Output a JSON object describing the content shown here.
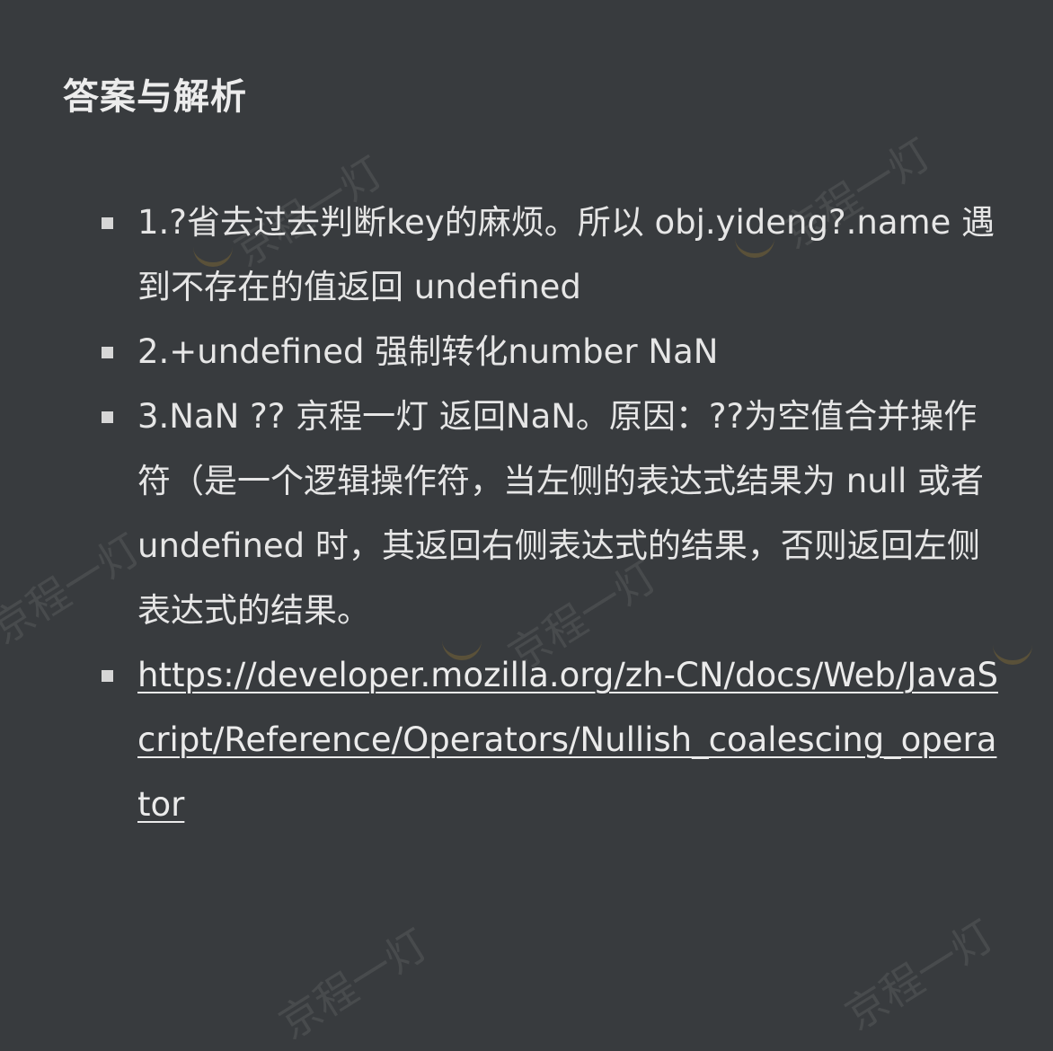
{
  "heading": "答案与解析",
  "items": [
    {
      "text": "1.?省去过去判断key的麻烦。所以 obj.yideng?.name 遇到不存在的值返回 undefined"
    },
    {
      "text": "2.+undefined 强制转化number NaN"
    },
    {
      "text": "3.NaN ?? 京程一灯 返回NaN。原因：??为空值合并操作符（是一个逻辑操作符，当左侧的表达式结果为 null 或者 undefined 时，其返回右侧表达式的结果，否则返回左侧表达式的结果。"
    },
    {
      "link": "https://developer.mozilla.org/zh-CN/docs/Web/JavaScript/Reference/Operators/Nullish_coalescing_operator"
    }
  ],
  "watermark": {
    "brand": "京程一灯"
  }
}
